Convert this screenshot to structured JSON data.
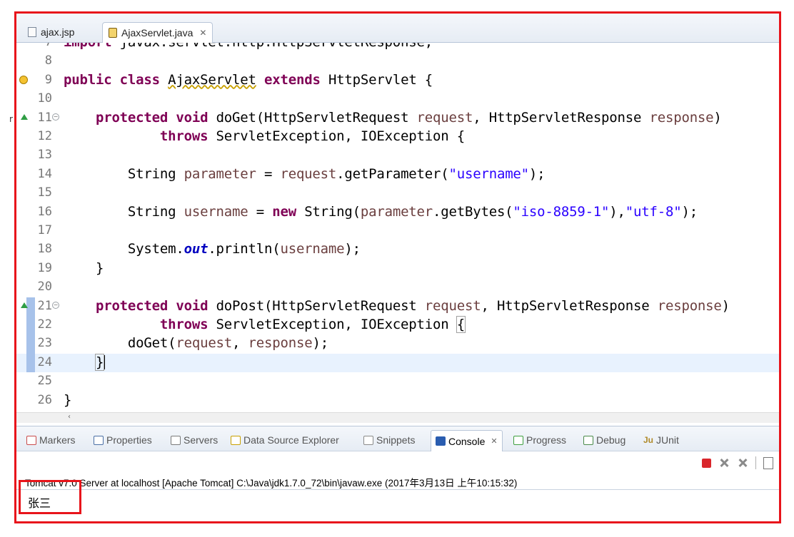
{
  "editor_tabs": [
    {
      "label": "ajax.jsp",
      "icon": "file-icon",
      "active": false
    },
    {
      "label": "AjaxServlet.java",
      "icon": "java-file-icon",
      "active": true,
      "close": "✕"
    }
  ],
  "code_lines": [
    {
      "num": "7",
      "html": "<span class=\"kw\">import</span> javax.servlet.http.HttpServletResponse;",
      "partial": true
    },
    {
      "num": "8",
      "html": ""
    },
    {
      "num": "9",
      "html": "<span class=\"kw\">public class</span> <span class=\"und\">AjaxServlet</span> <span class=\"kw\">extends</span> HttpServlet {",
      "marker": "warning"
    },
    {
      "num": "10",
      "html": ""
    },
    {
      "num": "11",
      "html": "    <span class=\"kw\">protected void</span> doGet(HttpServletRequest <span class=\"var\">request</span>, HttpServletResponse <span class=\"var\">response</span>)",
      "marker": "override",
      "fold": true
    },
    {
      "num": "12",
      "html": "            <span class=\"kw\">throws</span> ServletException, IOException {"
    },
    {
      "num": "13",
      "html": ""
    },
    {
      "num": "14",
      "html": "        String <span class=\"var\">parameter</span> = <span class=\"var\">request</span>.getParameter(<span class=\"str\">\"username\"</span>);"
    },
    {
      "num": "15",
      "html": ""
    },
    {
      "num": "16",
      "html": "        String <span class=\"var\">username</span> = <span class=\"kw\">new</span> String(<span class=\"var\">parameter</span>.getBytes(<span class=\"str\">\"iso-8859-1\"</span>),<span class=\"str\">\"utf-8\"</span>);"
    },
    {
      "num": "17",
      "html": ""
    },
    {
      "num": "18",
      "html": "        System.<span class=\"fld\">out</span>.println(<span class=\"var\">username</span>);"
    },
    {
      "num": "19",
      "html": "    }"
    },
    {
      "num": "20",
      "html": ""
    },
    {
      "num": "21",
      "html": "    <span class=\"kw\">protected void</span> doPost(HttpServletRequest <span class=\"var\">request</span>, HttpServletResponse <span class=\"var\">response</span>)",
      "marker": "override",
      "fold": true,
      "changed": true
    },
    {
      "num": "22",
      "html": "            <span class=\"kw\">throws</span> ServletException, IOException <span class=\"match\">{</span>",
      "changed": true
    },
    {
      "num": "23",
      "html": "        doGet(<span class=\"var\">request</span>, <span class=\"var\">response</span>);",
      "changed": true
    },
    {
      "num": "24",
      "html": "    <span class=\"match\">}</span><span class=\"caret\"></span>",
      "changed": true,
      "current": true
    },
    {
      "num": "25",
      "html": ""
    },
    {
      "num": "26",
      "html": "}"
    }
  ],
  "view_tabs": [
    {
      "label": "Markers",
      "icon": "markers-icon",
      "color": "#c94b4b"
    },
    {
      "label": "Properties",
      "icon": "properties-icon",
      "color": "#4a6fa5"
    },
    {
      "label": "Servers",
      "icon": "servers-icon",
      "color": "#7a7a7a"
    },
    {
      "label": "Data Source Explorer",
      "icon": "data-source-icon",
      "color": "#c8a000"
    },
    {
      "label": "Snippets",
      "icon": "snippets-icon",
      "color": "#8a8a8a"
    },
    {
      "label": "Console",
      "icon": "console-icon",
      "color": "#2a5db0",
      "active": true,
      "close": "✕"
    },
    {
      "label": "Progress",
      "icon": "progress-icon",
      "color": "#3f9f3f"
    },
    {
      "label": "Debug",
      "icon": "debug-icon",
      "color": "#4a8a4a"
    },
    {
      "label": "JUnit",
      "icon": "junit-icon",
      "color": "#b08a2a",
      "prefix": "Ju"
    }
  ],
  "console": {
    "title": "Tomcat v7.0 Server at localhost [Apache Tomcat] C:\\Java\\jdk1.7.0_72\\bin\\javaw.exe (2017年3月13日 上午10:15:32)",
    "output": "张三"
  },
  "side_glyph": "r"
}
